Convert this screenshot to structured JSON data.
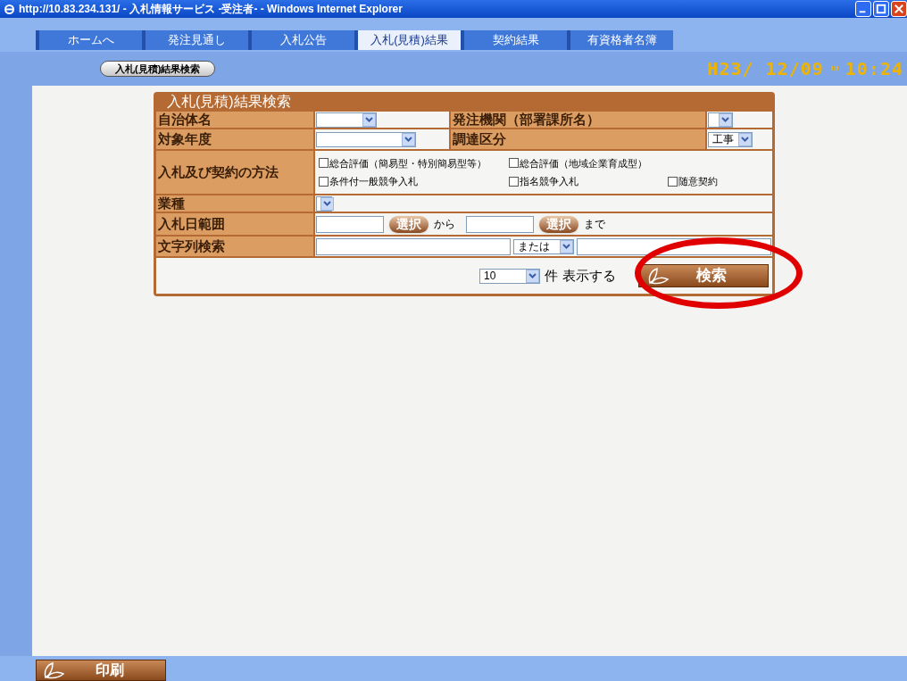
{
  "window": {
    "title": "http://10.83.234.131/ - 入札情報サービス -受注者- - Windows Internet Explorer"
  },
  "tabs": [
    {
      "label": "ホームへ",
      "selected": false
    },
    {
      "label": "発注見通し",
      "selected": false
    },
    {
      "label": "入札公告",
      "selected": false
    },
    {
      "label": "入札(見積)結果",
      "selected": true
    },
    {
      "label": "契約結果",
      "selected": false
    },
    {
      "label": "有資格者名簿",
      "selected": false
    }
  ],
  "subtab": {
    "label": "入札(見積)結果検索"
  },
  "clock": {
    "date": "H23/ 12/09",
    "time": "10:24"
  },
  "form": {
    "title": "入札(見積)結果検索",
    "municipality": {
      "label": "自治体名"
    },
    "agency": {
      "label": "発注機関（部署課所名）"
    },
    "fiscal_year": {
      "label": "対象年度"
    },
    "category": {
      "label": "調達区分",
      "value": "工事"
    },
    "method": {
      "label": "入札及び契約の方法",
      "options": [
        {
          "label": "総合評価（簡易型・特別簡易型等）",
          "checked": false
        },
        {
          "label": "総合評価（地域企業育成型）",
          "checked": false
        },
        {
          "label": "条件付一般競争入札",
          "checked": false
        },
        {
          "label": "指名競争入札",
          "checked": false
        },
        {
          "label": "随意契約",
          "checked": false
        }
      ]
    },
    "industry": {
      "label": "業種"
    },
    "date_range": {
      "label": "入札日範囲",
      "select_button": "選択",
      "from": "から",
      "select_button_2": "選択",
      "to": "まで"
    },
    "text_search": {
      "label": "文字列検索",
      "operator": "または"
    },
    "page_size": {
      "value": "10",
      "unit": "件",
      "suffix": "表示する"
    },
    "search_button": {
      "label": "検索",
      "highlighted": true
    }
  },
  "print_button": {
    "label": "印刷"
  }
}
